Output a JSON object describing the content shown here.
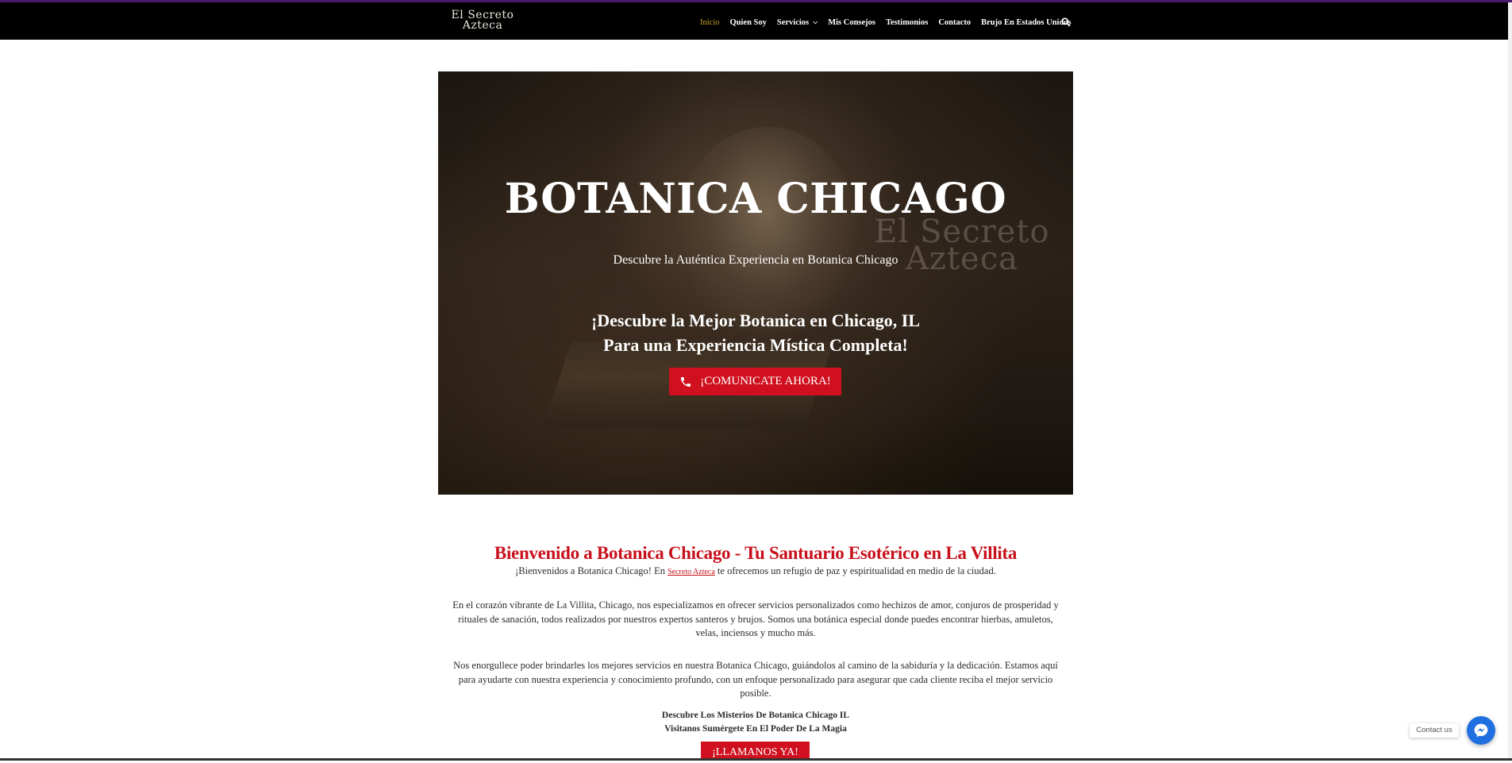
{
  "header": {
    "logo_line1": "El Secreto",
    "logo_line2": "Azteca",
    "nav": [
      {
        "label": "Inicio",
        "active": true
      },
      {
        "label": "Quien Soy"
      },
      {
        "label": "Servicios",
        "dropdown": true
      },
      {
        "label": "Mis Consejos"
      },
      {
        "label": "Testimonios"
      },
      {
        "label": "Contacto"
      },
      {
        "label": "Brujo En Estados Unidos"
      }
    ],
    "search_icon": "search-icon"
  },
  "hero": {
    "title": "BOTANICA CHICAGO",
    "subtitle": "Descubre la Auténtica Experiencia en Botanica Chicago",
    "tagline_line1": "¡Descubre la Mejor Botanica en Chicago, IL",
    "tagline_line2": "Para una Experiencia Mística Completa!",
    "cta_label": "¡COMUNICATE AHORA!",
    "cta_icon": "phone-icon",
    "watermark_line1": "El Secreto",
    "watermark_line2": "Azteca"
  },
  "welcome": {
    "title": "Bienvenido a Botanica Chicago - Tu Santuario Esotérico en La Villita",
    "p1_before": "¡Bienvenidos a Botanica Chicago! En ",
    "p1_link": "Secreto Azteca",
    "p1_after": " te ofrecemos un refugio de paz y espiritualidad en medio de la ciudad.",
    "p2": "En el corazón vibrante de La Villita, Chicago, nos especializamos en ofrecer servicios personalizados como hechizos de amor, conjuros de prosperidad y rituales de sanación, todos realizados por nuestros expertos santeros y brujos. Somos una botánica especial donde puedes encontrar hierbas, amuletos, velas, inciensos y mucho más.",
    "p3": "Nos enorgullece poder brindarles los mejores servicios en nuestra Botanica Chicago, guiándolos al camino de la sabiduría y la dedicación. Estamos aquí para ayudarte con nuestra experiencia y conocimiento profundo, con un enfoque personalizado para asegurar que cada cliente reciba el mejor servicio posible.",
    "p4_line1": "Descubre Los Misterios De Botanica Chicago IL",
    "p4_line2": "Visitanos Sumérgete En El Poder De La Magia",
    "call_label": "¡LLAMANOS YA!"
  },
  "widget": {
    "contact_label": "Contact us",
    "icon": "messenger-icon"
  },
  "colors": {
    "accent_red": "#d0101e",
    "active_nav": "#c9a227",
    "navbar_bg": "#000000",
    "top_line": "#4a1a6e",
    "messenger_blue": "#1f6fe0"
  }
}
